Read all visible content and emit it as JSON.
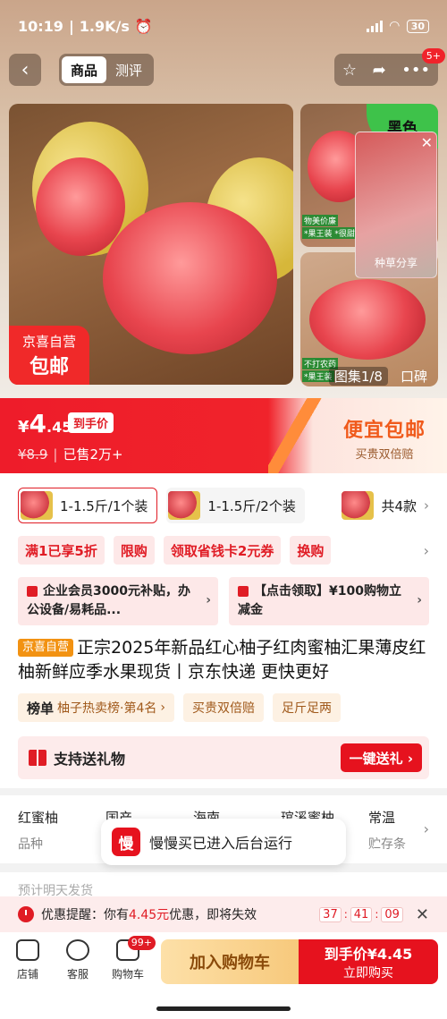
{
  "status_bar": {
    "time": "10:19",
    "speed": "1.9K/s",
    "battery": "30"
  },
  "nav": {
    "back_icon": "chevron-left-icon",
    "tabs": [
      {
        "label": "商品",
        "active": true
      },
      {
        "label": "测评",
        "active": false
      }
    ],
    "actions": [
      "star-icon",
      "share-icon",
      "more-icon"
    ],
    "more_badge": "5+"
  },
  "gallery": {
    "main_tag_line1": "京喜自营",
    "main_tag_line2": "包邮",
    "thumb_top_corner": "黑色",
    "thumb_label_1": "物美价廉",
    "thumb_label_2": "*果王装 *很甜",
    "thumb_label_3": "不打农药",
    "thumb_label_4": "*果王装",
    "video_caption": "种草分享",
    "gallery_counter": "图集1/8",
    "review_label": "口碑"
  },
  "price": {
    "yen": "¥",
    "integer": "4",
    "decimal": ".45",
    "tag": "到手价",
    "original": "¥8.9",
    "sold": "已售2万+",
    "promo_title": "便宜包邮",
    "promo_sub": "买贵双倍赔"
  },
  "variants": {
    "options": [
      {
        "label": "1-1.5斤/1个装",
        "selected": true
      },
      {
        "label": "1-1.5斤/2个装",
        "selected": false
      }
    ],
    "total": "共4款"
  },
  "coupons": [
    "满1已享5折",
    "限购",
    "领取省钱卡2元券",
    "换购"
  ],
  "benefits": [
    {
      "text": "企业会员3000元补贴，办公设备/易耗品..."
    },
    {
      "text": "【点击领取】¥100购物立减金"
    }
  ],
  "title": {
    "tag": "京喜自营",
    "text": "正宗2025年新品红心柚子红肉蜜柚汇果薄皮红柚新鲜应季水果现货丨京东快递 更快更好"
  },
  "ranks": [
    {
      "bold": "榜单",
      "text": "柚子热卖榜·第4名",
      "chevron": "›"
    },
    {
      "bold": "",
      "text": "买贵双倍赔",
      "chevron": ""
    },
    {
      "bold": "",
      "text": "足斤足两",
      "chevron": ""
    }
  ],
  "gift": {
    "text": "支持送礼物",
    "button": "一键送礼 ›"
  },
  "attributes": [
    {
      "value": "红蜜柚",
      "key": "品种"
    },
    {
      "value": "国产",
      "key": ""
    },
    {
      "value": "海南",
      "key": ""
    },
    {
      "value": "琯溪蜜柚",
      "key": ""
    },
    {
      "value": "常温",
      "key": "贮存条"
    }
  ],
  "toast": {
    "logo": "慢",
    "text": "慢慢买已进入后台运行"
  },
  "shipping_faded": "预计明天发货",
  "reminder": {
    "prefix": "优惠提醒：你有",
    "amount": "4.45元",
    "suffix": "优惠，即将失效",
    "hours": "37",
    "minutes": "41",
    "seconds": "09"
  },
  "bottom": {
    "store": "店铺",
    "service": "客服",
    "cart": "购物车",
    "cart_badge": "99+",
    "add_cart": "加入购物车",
    "buy_line1": "到手价¥4.45",
    "buy_line2": "立即购买"
  }
}
